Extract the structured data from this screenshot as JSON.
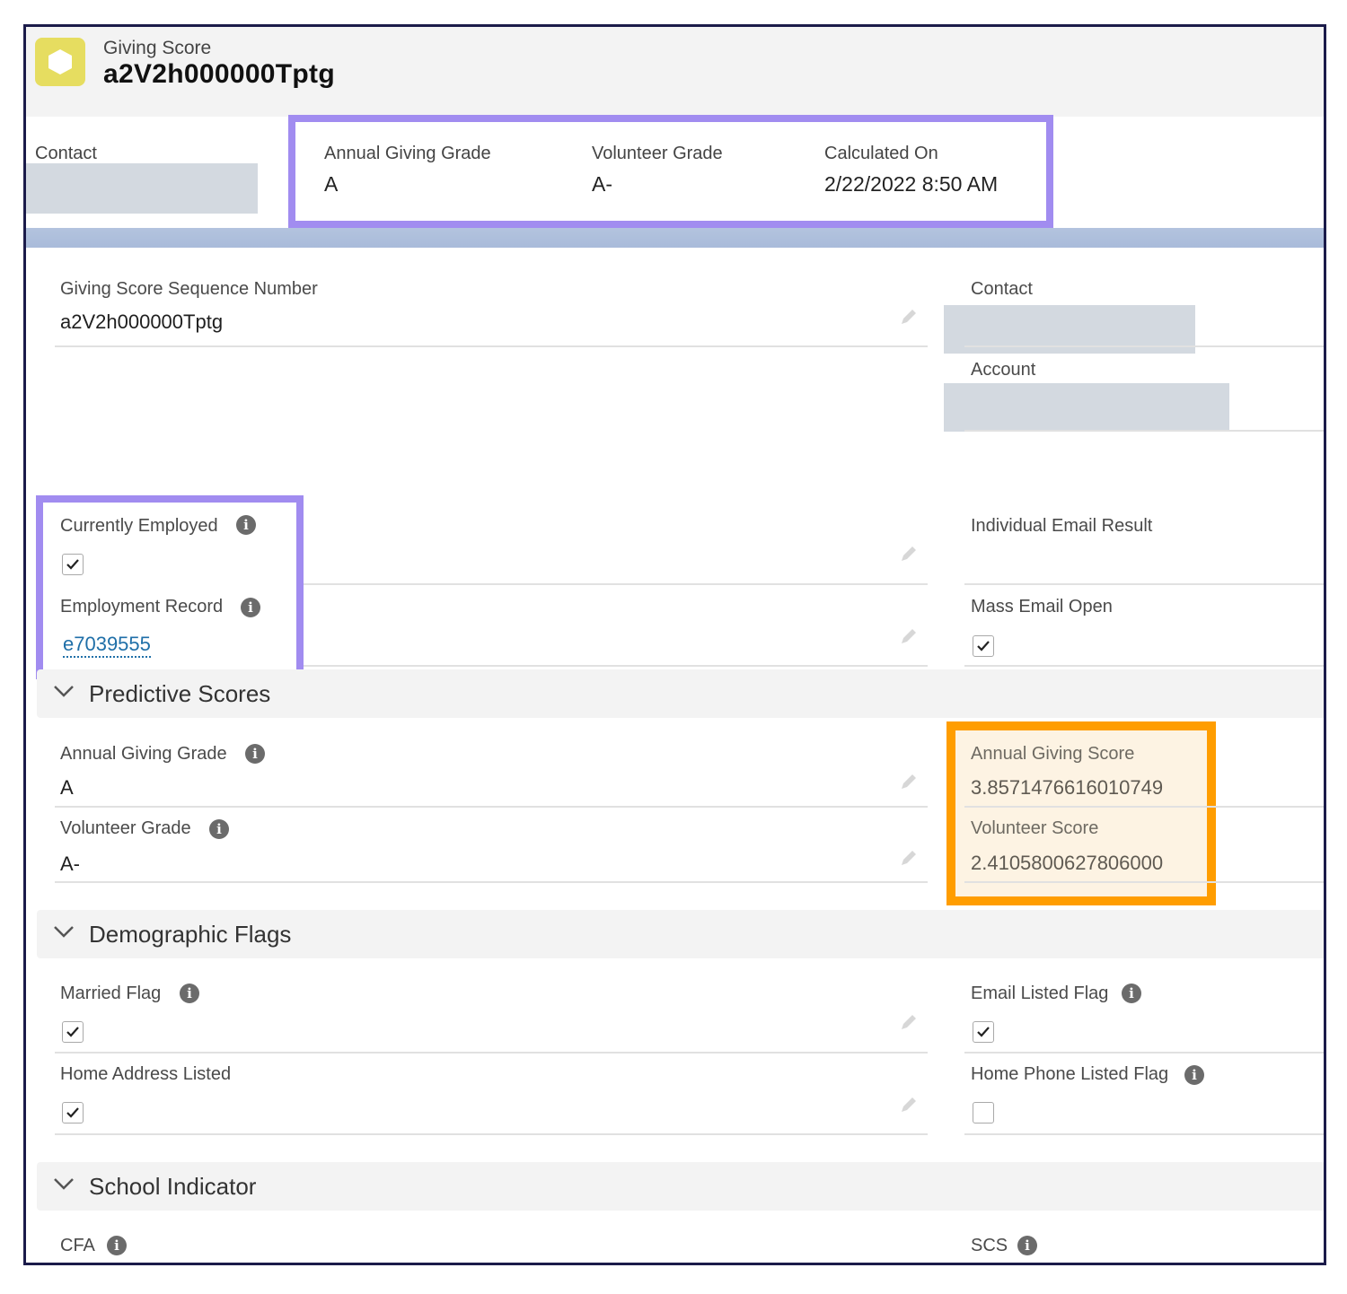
{
  "header": {
    "object_label": "Giving Score",
    "record_name": "a2V2h000000Tptg",
    "icon": "hexagon-icon"
  },
  "highlights": {
    "contact_label": "Contact",
    "fields": [
      {
        "label": "Annual Giving Grade",
        "value": "A"
      },
      {
        "label": "Volunteer Grade",
        "value": "A-"
      },
      {
        "label": "Calculated On",
        "value": "2/22/2022 8:50 AM"
      }
    ]
  },
  "details": {
    "sequence": {
      "label": "Giving Score Sequence Number",
      "value": "a2V2h000000Tptg"
    },
    "contact_label": "Contact",
    "account_label": "Account",
    "currently_employed": {
      "label": "Currently Employed",
      "checked": true
    },
    "employment_record": {
      "label": "Employment Record",
      "value": "e7039555"
    },
    "individual_email_result": {
      "label": "Individual Email Result"
    },
    "mass_email_open": {
      "label": "Mass Email Open",
      "checked": true
    }
  },
  "sections": {
    "predictive": {
      "title": "Predictive Scores",
      "annual_giving_grade": {
        "label": "Annual Giving Grade",
        "value": "A"
      },
      "volunteer_grade": {
        "label": "Volunteer Grade",
        "value": "A-"
      },
      "annual_giving_score": {
        "label": "Annual Giving Score",
        "value": "3.8571476616010749"
      },
      "volunteer_score": {
        "label": "Volunteer Score",
        "value": "2.4105800627806000"
      }
    },
    "demographic": {
      "title": "Demographic Flags",
      "married_flag": {
        "label": "Married Flag",
        "checked": true
      },
      "home_address_listed": {
        "label": "Home Address Listed",
        "checked": true
      },
      "email_listed_flag": {
        "label": "Email Listed Flag",
        "checked": true
      },
      "home_phone_listed_flag": {
        "label": "Home Phone Listed Flag",
        "checked": false
      }
    },
    "school": {
      "title": "School Indicator",
      "cfa_label": "CFA",
      "scs_label": "SCS"
    }
  },
  "colors": {
    "highlight_purple": "#a18cf0",
    "highlight_orange": "#ff9d00",
    "icon_yellow": "#e6dd60",
    "link_blue": "#1f6fa8"
  }
}
